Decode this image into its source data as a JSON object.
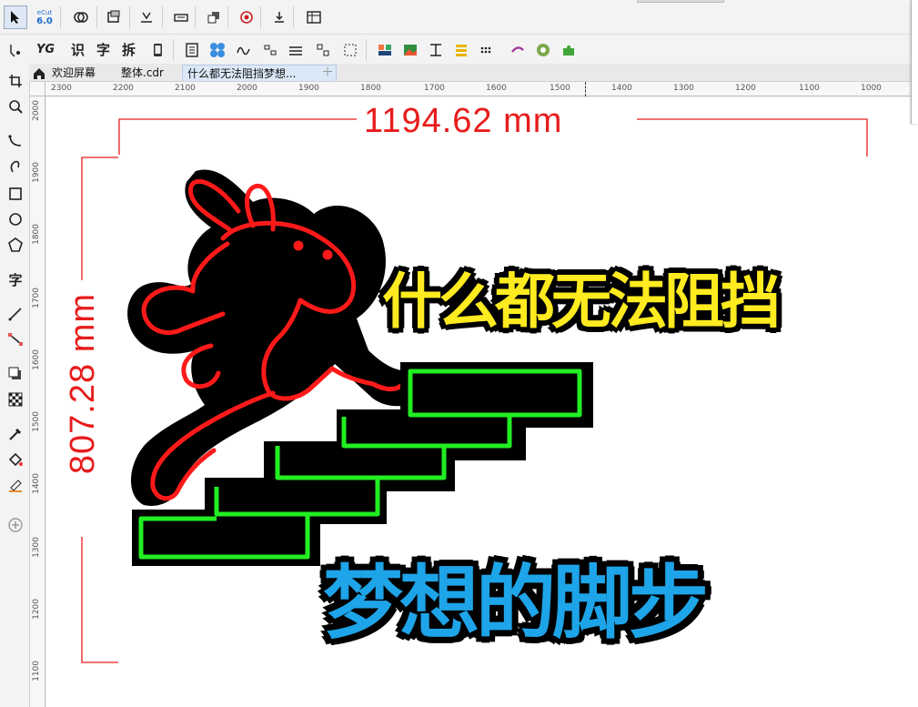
{
  "toolbar_top": {
    "cut_badge_top": "eCut",
    "cut_badge_bottom": "6.0"
  },
  "toolbar_second": {
    "yg_label": "YG",
    "btn_shi": "识",
    "btn_zi": "字",
    "btn_chai": "拆"
  },
  "tabs": [
    {
      "label": "欢迎屏幕"
    },
    {
      "label": "整体.cdr"
    },
    {
      "label": "什么都无法阻挡梦想..."
    }
  ],
  "toolbox": {
    "text_tool_label": "字"
  },
  "ruler": {
    "h_ticks": [
      "2300",
      "2200",
      "2100",
      "2000",
      "1900",
      "1800",
      "1700",
      "1600",
      "1500",
      "1400",
      "1300",
      "1200",
      "1100",
      "1000"
    ],
    "v_ticks": [
      "2000",
      "1900",
      "1800",
      "1700",
      "1600",
      "1500",
      "1400",
      "1300",
      "1200",
      "1100"
    ]
  },
  "canvas": {
    "width_dimension": "1194.62 mm",
    "height_dimension": "807.28 mm",
    "slogan_top": "什么都无法阻挡",
    "slogan_bottom": "梦想的脚步",
    "colors": {
      "dimension": "#e81c1c",
      "slogan_top": "#ffeb1f",
      "slogan_bottom": "#1ea4e8",
      "rabbit_outline": "#ff1a1a",
      "stairs_outline": "#22ee22",
      "backing": "#000000"
    }
  }
}
